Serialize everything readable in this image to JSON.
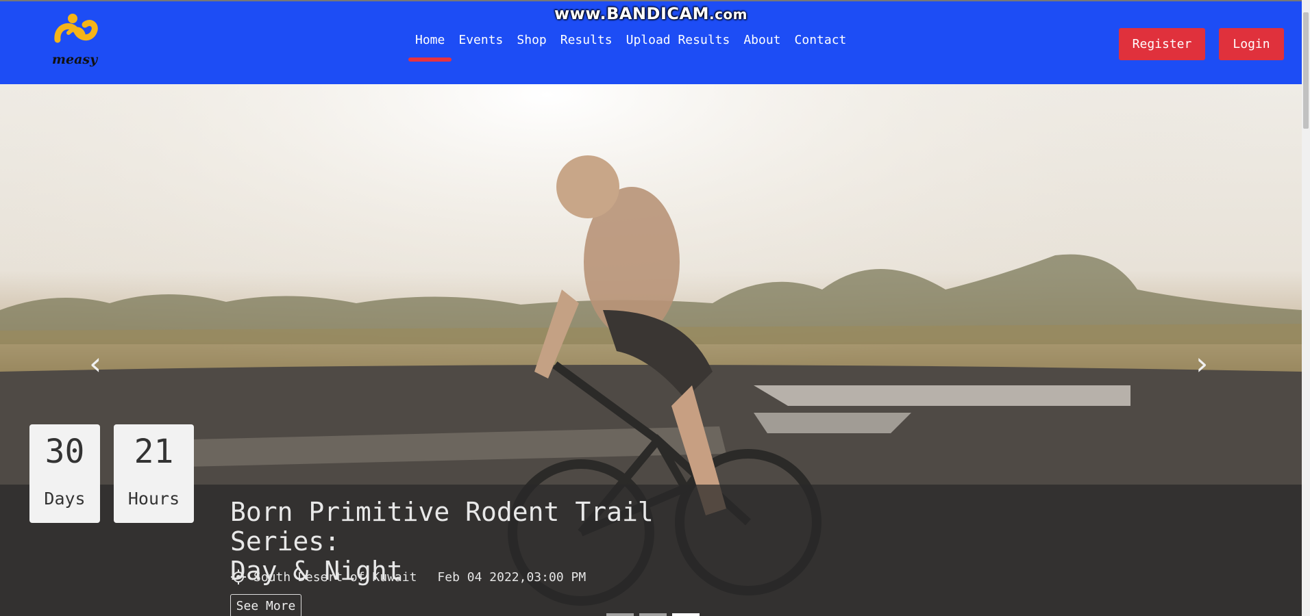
{
  "watermark": {
    "main": "www.BANDICAM",
    "suffix": ".com"
  },
  "brand": {
    "logo_text": "measy"
  },
  "nav": {
    "items": [
      "Home",
      "Events",
      "Shop",
      "Results",
      "Upload Results",
      "About",
      "Contact"
    ],
    "active": "Home"
  },
  "auth": {
    "register_label": "Register",
    "login_label": "Login"
  },
  "colors": {
    "header_bg": "#1d4df5",
    "accent": "#e0313c",
    "logo_yellow": "#f5b418"
  },
  "hero": {
    "countdown": {
      "days_value": "30",
      "days_label": "Days",
      "hours_value": "21",
      "hours_label": "Hours"
    },
    "event": {
      "title_line1": "Born Primitive Rodent Trail Series:",
      "title_line2": "Day & Night",
      "location": "South Desert of Kuwait",
      "datetime": "Feb 04 2022,03:00 PM",
      "cta_label": "See More"
    },
    "carousel": {
      "slide_count": 3,
      "active_slide": 3,
      "prev_icon": "chevron-left-icon",
      "next_icon": "chevron-right-icon"
    }
  }
}
